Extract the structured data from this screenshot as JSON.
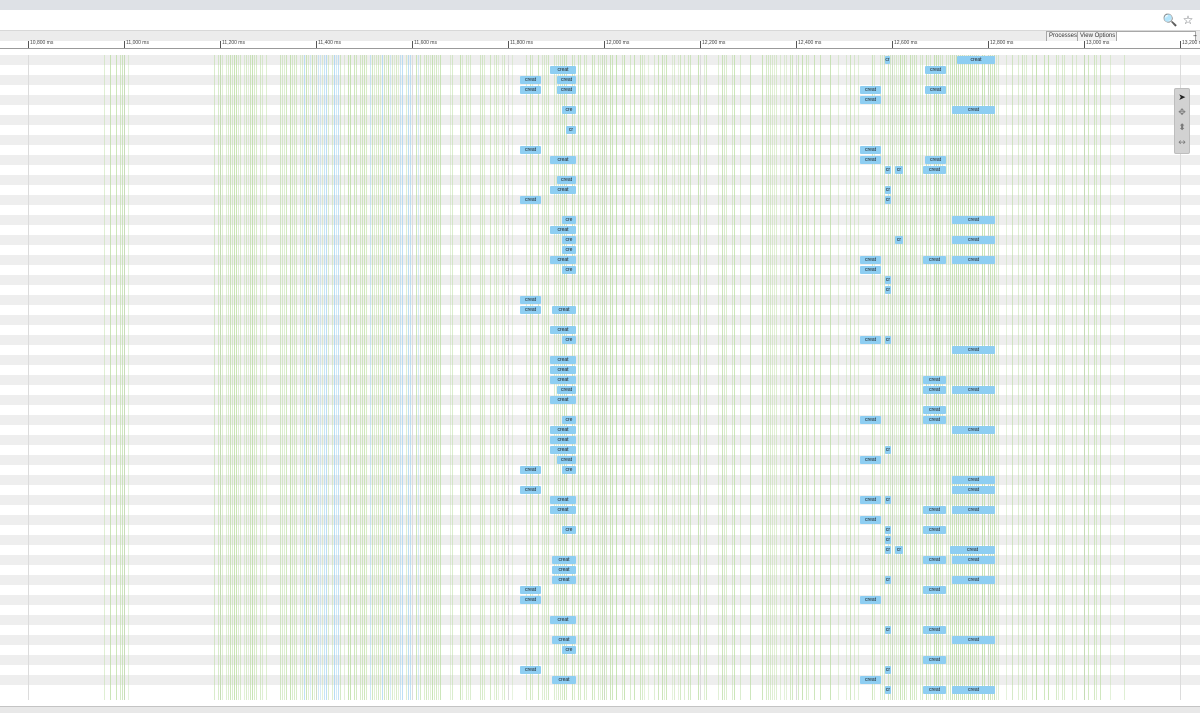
{
  "toolbar": {
    "icons": [
      "zoom-icon",
      "star-icon"
    ],
    "zoom_glyph": "🔍",
    "star_glyph": "☆"
  },
  "options_bar": {
    "processes_label": "Processes",
    "view_options_label": "View Options",
    "search_value": "",
    "collapse_glyph": "–"
  },
  "ruler": {
    "ticks": [
      "10,800 ms",
      "11,000 ms",
      "11,200 ms",
      "11,400 ms",
      "11,600 ms",
      "11,800 ms",
      "12,000 ms",
      "12,200 ms",
      "12,400 ms",
      "12,600 ms",
      "12,800 ms",
      "13,000 ms",
      "13,200 ms"
    ]
  },
  "colors": {
    "slice": "#8ecef2",
    "row_alt": "#eeeeee",
    "sample_green": "#b9dca0",
    "sample_blue": "#9fd2f0"
  },
  "tool_panel": {
    "tools": [
      {
        "name": "select-tool-icon",
        "glyph": "➤"
      },
      {
        "name": "pan-tool-icon",
        "glyph": "✥"
      },
      {
        "name": "zoom-tool-icon",
        "glyph": "⬍"
      },
      {
        "name": "timing-tool-icon",
        "glyph": "↔"
      }
    ]
  },
  "track_count": 64,
  "slices": [
    [
      [
        957,
        995,
        "creat"
      ],
      [
        885,
        890,
        "cr"
      ]
    ],
    [
      [
        550,
        576,
        "creat"
      ],
      [
        925,
        946,
        "creat"
      ]
    ],
    [
      [
        520,
        541,
        "creat"
      ],
      [
        557,
        576,
        "creat"
      ]
    ],
    [
      [
        520,
        541,
        "creat"
      ],
      [
        557,
        576,
        "creat"
      ],
      [
        860,
        881,
        "creat"
      ],
      [
        925,
        946,
        "creat"
      ]
    ],
    [
      [
        860,
        881,
        "creat"
      ]
    ],
    [
      [
        562,
        576,
        "cre"
      ],
      [
        952,
        995,
        "creat"
      ]
    ],
    [],
    [
      [
        566,
        576,
        "cr"
      ]
    ],
    [],
    [
      [
        520,
        541,
        "creat"
      ],
      [
        860,
        881,
        "creat"
      ]
    ],
    [
      [
        550,
        576,
        "creat"
      ],
      [
        860,
        881,
        "creat"
      ],
      [
        925,
        946,
        "creat"
      ]
    ],
    [
      [
        885,
        891,
        "cr"
      ],
      [
        895,
        903,
        "cr"
      ],
      [
        923,
        946,
        "creat"
      ]
    ],
    [
      [
        557,
        576,
        "creat"
      ]
    ],
    [
      [
        550,
        576,
        "creat"
      ],
      [
        885,
        891,
        "cr"
      ]
    ],
    [
      [
        520,
        541,
        "creat"
      ],
      [
        885,
        891,
        "cr"
      ]
    ],
    [],
    [
      [
        562,
        576,
        "cre"
      ],
      [
        952,
        995,
        "creat"
      ]
    ],
    [
      [
        550,
        576,
        "creat"
      ]
    ],
    [
      [
        562,
        576,
        "cre"
      ],
      [
        895,
        903,
        "cr"
      ],
      [
        952,
        995,
        "creat"
      ]
    ],
    [
      [
        562,
        576,
        "cre"
      ]
    ],
    [
      [
        550,
        576,
        "creat"
      ],
      [
        860,
        881,
        "creat"
      ],
      [
        923,
        946,
        "creat"
      ],
      [
        952,
        995,
        "creat"
      ]
    ],
    [
      [
        562,
        576,
        "cre"
      ],
      [
        860,
        881,
        "creat"
      ]
    ],
    [
      [
        885,
        891,
        "cr"
      ]
    ],
    [
      [
        885,
        891,
        "cr"
      ]
    ],
    [
      [
        520,
        541,
        "creat"
      ]
    ],
    [
      [
        520,
        541,
        "creat"
      ],
      [
        552,
        576,
        "creat"
      ]
    ],
    [],
    [
      [
        550,
        576,
        "creat"
      ]
    ],
    [
      [
        562,
        576,
        "cre"
      ],
      [
        860,
        881,
        "creat"
      ],
      [
        885,
        891,
        "cr"
      ]
    ],
    [
      [
        952,
        995,
        "creat"
      ]
    ],
    [
      [
        550,
        576,
        "creat"
      ]
    ],
    [
      [
        550,
        576,
        "creat"
      ]
    ],
    [
      [
        550,
        576,
        "creat"
      ],
      [
        923,
        946,
        "creat"
      ]
    ],
    [
      [
        557,
        576,
        "creat"
      ],
      [
        923,
        946,
        "creat"
      ],
      [
        952,
        995,
        "creat"
      ]
    ],
    [
      [
        550,
        576,
        "creat"
      ]
    ],
    [
      [
        923,
        946,
        "creat"
      ]
    ],
    [
      [
        562,
        576,
        "cre"
      ],
      [
        860,
        881,
        "creat"
      ],
      [
        923,
        946,
        "creat"
      ]
    ],
    [
      [
        550,
        576,
        "creat"
      ],
      [
        952,
        995,
        "creat"
      ]
    ],
    [
      [
        550,
        576,
        "creat"
      ]
    ],
    [
      [
        550,
        576,
        "creat"
      ],
      [
        885,
        891,
        "cr"
      ]
    ],
    [
      [
        557,
        576,
        "creat"
      ],
      [
        860,
        881,
        "creat"
      ]
    ],
    [
      [
        520,
        541,
        "creat"
      ],
      [
        562,
        576,
        "cre"
      ]
    ],
    [
      [
        952,
        995,
        "creat"
      ]
    ],
    [
      [
        520,
        541,
        "creat"
      ],
      [
        952,
        995,
        "creat"
      ]
    ],
    [
      [
        550,
        576,
        "creat"
      ],
      [
        860,
        881,
        "creat"
      ],
      [
        885,
        891,
        "cr"
      ]
    ],
    [
      [
        550,
        576,
        "creat"
      ],
      [
        923,
        946,
        "creat"
      ],
      [
        952,
        995,
        "creat"
      ]
    ],
    [
      [
        860,
        881,
        "creat"
      ]
    ],
    [
      [
        562,
        576,
        "cre"
      ],
      [
        885,
        891,
        "cr"
      ],
      [
        923,
        946,
        "creat"
      ]
    ],
    [
      [
        885,
        891,
        "cr"
      ]
    ],
    [
      [
        885,
        891,
        "cr"
      ],
      [
        895,
        903,
        "cr"
      ],
      [
        950,
        995,
        "creat"
      ]
    ],
    [
      [
        552,
        576,
        "creat"
      ],
      [
        923,
        946,
        "creat"
      ],
      [
        952,
        995,
        "creat"
      ]
    ],
    [
      [
        552,
        576,
        "creat"
      ]
    ],
    [
      [
        552,
        576,
        "creat"
      ],
      [
        885,
        891,
        "cr"
      ],
      [
        952,
        995,
        "creat"
      ]
    ],
    [
      [
        520,
        541,
        "creat"
      ],
      [
        923,
        946,
        "creat"
      ]
    ],
    [
      [
        520,
        541,
        "creat"
      ],
      [
        860,
        881,
        "creat"
      ]
    ],
    [],
    [
      [
        550,
        576,
        "creat"
      ]
    ],
    [
      [
        885,
        891,
        "cr"
      ],
      [
        923,
        946,
        "creat"
      ]
    ],
    [
      [
        552,
        576,
        "creat"
      ],
      [
        952,
        995,
        "creat"
      ]
    ],
    [
      [
        562,
        576,
        "cre"
      ]
    ],
    [
      [
        923,
        946,
        "creat"
      ]
    ],
    [
      [
        520,
        541,
        "creat"
      ],
      [
        885,
        891,
        "cr"
      ]
    ],
    [
      [
        552,
        576,
        "creat"
      ],
      [
        860,
        881,
        "creat"
      ]
    ],
    [
      [
        885,
        891,
        "cr"
      ],
      [
        923,
        946,
        "creat"
      ],
      [
        952,
        995,
        "creat"
      ]
    ]
  ]
}
